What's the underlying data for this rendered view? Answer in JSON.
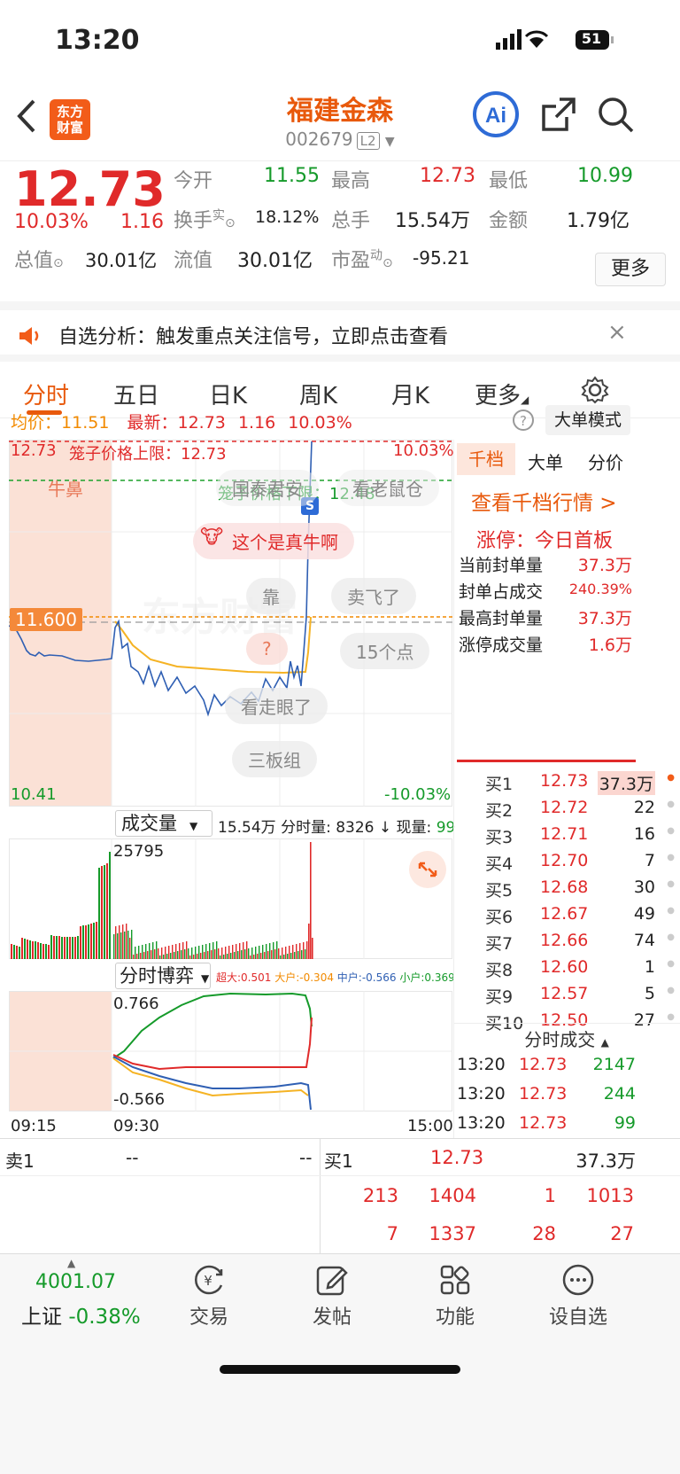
{
  "status": {
    "time": "13:20",
    "battery": "51"
  },
  "header": {
    "logo_line1": "东方",
    "logo_line2": "财富",
    "title": "福建金森",
    "code": "002679",
    "level": "L2"
  },
  "quote": {
    "price": "12.73",
    "change_pct": "10.03%",
    "change": "1.16",
    "open_label": "今开",
    "open": "11.55",
    "high_label": "最高",
    "high": "12.73",
    "low_label": "最低",
    "low": "10.99",
    "turnover_label": "换手",
    "turnover_sup": "实",
    "turnover": "18.12%",
    "volume_label": "总手",
    "volume": "15.54万",
    "amount_label": "金额",
    "amount": "1.79亿",
    "mktcap_label": "总值",
    "mktcap": "30.01亿",
    "float_label": "流值",
    "float": "30.01亿",
    "pe_label": "市盈",
    "pe_sup": "动",
    "pe": "-95.21",
    "more": "更多"
  },
  "notice": {
    "text": "自选分析：触发重点关注信号，立即点击查看",
    "close": "×"
  },
  "tabs": [
    "分时",
    "五日",
    "日K",
    "周K",
    "月K",
    "更多"
  ],
  "avgline": {
    "avg_label": "均价：",
    "avg": "11.51",
    "latest_label": "最新：",
    "latest": "12.73",
    "chg": "1.16",
    "pct": "10.03%",
    "mode": "大单模式"
  },
  "chart": {
    "top_price": "12.73",
    "top_pct": "10.03%",
    "upper_limit": "笼子价格上限：12.73",
    "lower_limit": "笼子价格下限：12.48",
    "ref_price": "11.600",
    "low_price": "10.41",
    "low_pct": "-10.03%",
    "badge": "S",
    "bubbles": [
      "牛鼻",
      "国泰君安",
      "看老鼠仓",
      "这个是真牛啊",
      "靠",
      "卖飞了",
      "?",
      "15个点",
      "看走眼了",
      "三板组"
    ],
    "watermark": "东方财富"
  },
  "chart_data": {
    "type": "line",
    "x_start": "09:15",
    "x_open": "09:30",
    "x_end": "15:00",
    "ylim": [
      10.41,
      12.73
    ],
    "reference": 11.6
  },
  "volume": {
    "selector": "成交量",
    "total": "15.54万",
    "fen_label": "分时量:",
    "fen": "8326",
    "arrow": "↓",
    "now_label": "现量:",
    "now": "99",
    "max": "25795"
  },
  "game": {
    "selector": "分时博弈",
    "sd_label": "超大:",
    "sd": "0.501",
    "d_label": "大户:",
    "d": "-0.304",
    "z_label": "中户:",
    "z": "-0.566",
    "x_label": "小户:",
    "x": "0.369",
    "top": "0.766",
    "bottom": "-0.566"
  },
  "axis": {
    "t1": "09:15",
    "t2": "09:30",
    "t3": "15:00"
  },
  "side": {
    "tabs": [
      "千档",
      "大单",
      "分价"
    ],
    "link": "查看千档行情 >",
    "limit_title": "涨停：今日首板",
    "rows": [
      {
        "k": "当前封单量",
        "v": "37.3万"
      },
      {
        "k": "封单占成交",
        "v": "240.39%"
      },
      {
        "k": "最高封单量",
        "v": "37.3万"
      },
      {
        "k": "涨停成交量",
        "v": "1.6万"
      }
    ]
  },
  "book": [
    {
      "l": "买1",
      "p": "12.73",
      "v": "37.3万"
    },
    {
      "l": "买2",
      "p": "12.72",
      "v": "22"
    },
    {
      "l": "买3",
      "p": "12.71",
      "v": "16"
    },
    {
      "l": "买4",
      "p": "12.70",
      "v": "7"
    },
    {
      "l": "买5",
      "p": "12.68",
      "v": "30"
    },
    {
      "l": "买6",
      "p": "12.67",
      "v": "49"
    },
    {
      "l": "买7",
      "p": "12.66",
      "v": "74"
    },
    {
      "l": "买8",
      "p": "12.60",
      "v": "1"
    },
    {
      "l": "买9",
      "p": "12.57",
      "v": "5"
    },
    {
      "l": "买10",
      "p": "12.50",
      "v": "27"
    }
  ],
  "trades": {
    "title": "分时成交",
    "rows": [
      {
        "t": "13:20",
        "p": "12.73",
        "v": "2147"
      },
      {
        "t": "13:20",
        "p": "12.73",
        "v": "244"
      },
      {
        "t": "13:20",
        "p": "12.73",
        "v": "99"
      }
    ]
  },
  "summary": {
    "sell_label": "卖1",
    "sell_p": "--",
    "sell_v": "--",
    "buy_label": "买1",
    "buy_p": "12.73",
    "buy_v": "37.3万",
    "r1": [
      "213",
      "1404",
      "1",
      "1013"
    ],
    "r2": [
      "7",
      "1337",
      "28",
      "27"
    ]
  },
  "nav": {
    "index_val": "4001.07",
    "index_name": "上证",
    "index_pct": "-0.38%",
    "trade": "交易",
    "post": "发帖",
    "func": "功能",
    "watch": "设自选"
  },
  "colors": {
    "up": "#e02a2a",
    "down": "#159a2a",
    "brand": "#f25c19",
    "accent": "#2e6bd6"
  }
}
